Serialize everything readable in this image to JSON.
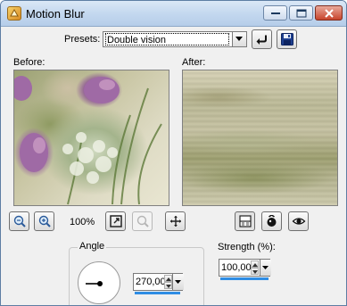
{
  "window": {
    "title": "Motion Blur",
    "controls": {
      "minimize": "minimize-icon",
      "maximize": "maximize-icon",
      "close": "close-icon"
    }
  },
  "presets": {
    "label": "Presets:",
    "value": "Double vision",
    "icons": {
      "reset": "reset-icon",
      "save": "save-icon"
    }
  },
  "previews": {
    "before_label": "Before:",
    "after_label": "After:"
  },
  "toolbar": {
    "zoom_level": "100%",
    "icons": {
      "zoom_in": "zoom-in-icon",
      "zoom_out": "zoom-out-icon",
      "zoom_fit": "zoom-fit-icon",
      "zoom_actual_disabled": "zoom-actual-icon",
      "navigate": "move-icon",
      "proof": "proof-toggle-icon",
      "randomize": "randomize-icon",
      "preview_toggle": "eye-icon"
    }
  },
  "angle": {
    "label": "Angle",
    "value": "270,00",
    "dial_degrees": 270
  },
  "strength": {
    "label": "Strength (%):",
    "value": "100,00"
  },
  "colors": {
    "accent": "#2f8de4",
    "titlebar": "#c4d8ef"
  }
}
